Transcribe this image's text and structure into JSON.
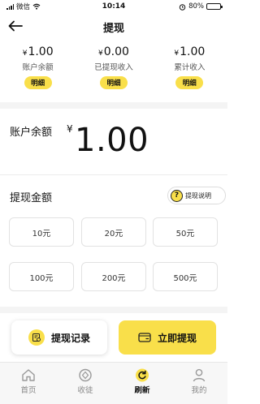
{
  "status_bar": {
    "carrier": "微信",
    "time": "10:14",
    "battery": "80%"
  },
  "header": {
    "title": "提现"
  },
  "stats": [
    {
      "currency": "¥",
      "value": "1.00",
      "label": "账户余额",
      "detail_label": "明细"
    },
    {
      "currency": "¥",
      "value": "0.00",
      "label": "已提现收入",
      "detail_label": "明细"
    },
    {
      "currency": "¥",
      "value": "1.00",
      "label": "累计收入",
      "detail_label": "明细"
    }
  ],
  "balance": {
    "label": "账户余额",
    "currency": "¥",
    "amount": "1.00"
  },
  "withdraw": {
    "title": "提现金额",
    "help_label": "提现说明",
    "help_icon_glyph": "?",
    "amounts": [
      "10元",
      "20元",
      "50元",
      "100元",
      "200元",
      "500元"
    ]
  },
  "actions": {
    "records_label": "提现记录",
    "withdraw_label": "立即提现"
  },
  "tabs": [
    {
      "label": "首页",
      "icon": "home-icon",
      "active": false
    },
    {
      "label": "收徒",
      "icon": "recruit-icon",
      "active": false
    },
    {
      "label": "刷新",
      "icon": "refresh-icon",
      "active": true
    },
    {
      "label": "我的",
      "icon": "user-icon",
      "active": false
    }
  ],
  "colors": {
    "accent": "#f9df4a",
    "divider": "#f4f4f4",
    "tab_bar_bg": "#f7f7f7"
  }
}
